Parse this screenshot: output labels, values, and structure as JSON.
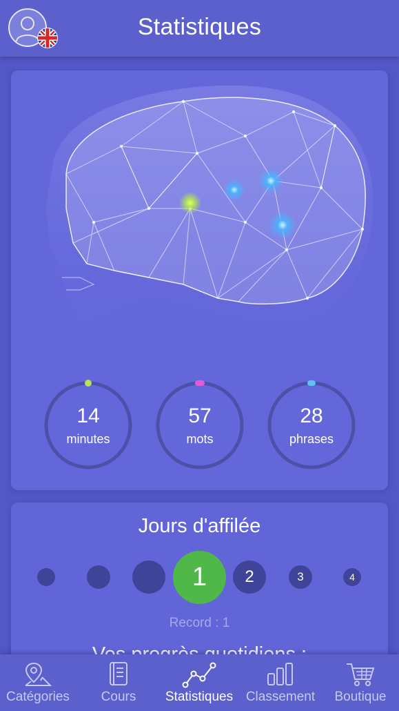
{
  "header": {
    "title": "Statistiques",
    "avatar_icon": "user-avatar-icon",
    "flag_icon": "uk-flag-icon"
  },
  "brain": {
    "image": "brain-head-illustration",
    "dot_colors": [
      "#c5f542",
      "#4fb8ff",
      "#4fb8ff",
      "#4fb8ff"
    ]
  },
  "stats": [
    {
      "value": "14",
      "label": "minutes",
      "accent": "#b6e25a"
    },
    {
      "value": "57",
      "label": "mots",
      "accent": "#e25ad6"
    },
    {
      "value": "28",
      "label": "phrases",
      "accent": "#5ac4ee"
    }
  ],
  "streak": {
    "title": "Jours d'affilée",
    "days": [
      "",
      "",
      "",
      "1",
      "2",
      "3",
      "4"
    ],
    "current_index": 3,
    "record": "Record : 1"
  },
  "progress": {
    "title": "Vos progrès quotidiens :"
  },
  "tabs": [
    {
      "label": "Catégories",
      "icon": "map-pin-icon",
      "active": false
    },
    {
      "label": "Cours",
      "icon": "book-icon",
      "active": false
    },
    {
      "label": "Statistiques",
      "icon": "line-chart-icon",
      "active": true
    },
    {
      "label": "Classement",
      "icon": "bar-chart-icon",
      "active": false
    },
    {
      "label": "Boutique",
      "icon": "cart-icon",
      "active": false
    }
  ],
  "colors": {
    "background": "#5358c6",
    "card": "#6467da",
    "header": "#5b60cc",
    "streak_current": "#4fb849",
    "streak_dot": "#3f4498"
  }
}
